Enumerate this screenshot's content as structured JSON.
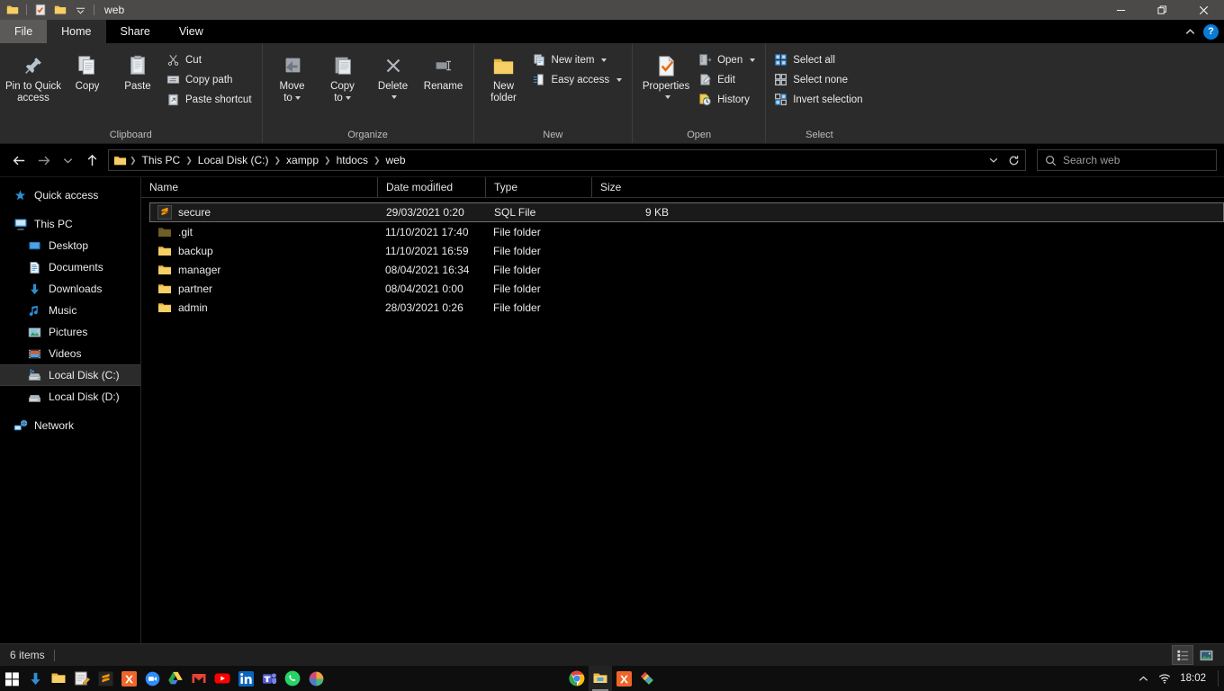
{
  "window": {
    "title": "web",
    "quick_access": [
      "folder-icon",
      "properties-icon",
      "new-folder-icon",
      "customize-qat-caret"
    ],
    "controls": {
      "minimize": "minimize-button",
      "maximize": "restore-button",
      "close": "close-button"
    }
  },
  "ribbon": {
    "tabs": [
      {
        "label": "File",
        "state": "file"
      },
      {
        "label": "Home",
        "state": "active"
      },
      {
        "label": "Share",
        "state": "normal"
      },
      {
        "label": "View",
        "state": "normal"
      }
    ],
    "collapse_label": "^",
    "help_label": "?",
    "groups": [
      {
        "label": "Clipboard",
        "big": [
          {
            "label1": "Pin to Quick",
            "label2": "access",
            "icon": "pin-icon"
          },
          {
            "label1": "Copy",
            "label2": "",
            "icon": "copy-icon"
          },
          {
            "label1": "Paste",
            "label2": "",
            "icon": "paste-icon"
          }
        ],
        "small": [
          {
            "label": "Cut",
            "icon": "scissors-icon"
          },
          {
            "label": "Copy path",
            "icon": "copy-path-icon"
          },
          {
            "label": "Paste shortcut",
            "icon": "paste-shortcut-icon"
          }
        ]
      },
      {
        "label": "Organize",
        "big": [
          {
            "label1": "Move",
            "label2": "to",
            "icon": "move-to-icon",
            "caret": true
          },
          {
            "label1": "Copy",
            "label2": "to",
            "icon": "copy-to-icon",
            "caret": true
          },
          {
            "label1": "Delete",
            "label2": "",
            "icon": "delete-icon",
            "caret_below": true
          },
          {
            "label1": "Rename",
            "label2": "",
            "icon": "rename-icon"
          }
        ],
        "small": []
      },
      {
        "label": "New",
        "big": [
          {
            "label1": "New",
            "label2": "folder",
            "icon": "new-folder-icon"
          }
        ],
        "small": [
          {
            "label": "New item",
            "icon": "new-item-icon",
            "caret": true
          },
          {
            "label": "Easy access",
            "icon": "easy-access-icon",
            "caret": true
          }
        ]
      },
      {
        "label": "Open",
        "big": [
          {
            "label1": "Properties",
            "label2": "",
            "icon": "properties-icon",
            "caret_below": true
          }
        ],
        "small": [
          {
            "label": "Open",
            "icon": "open-icon",
            "caret": true
          },
          {
            "label": "Edit",
            "icon": "edit-icon"
          },
          {
            "label": "History",
            "icon": "history-icon"
          }
        ]
      },
      {
        "label": "Select",
        "big": [],
        "small": [
          {
            "label": "Select all",
            "icon": "select-all-icon"
          },
          {
            "label": "Select none",
            "icon": "select-none-icon"
          },
          {
            "label": "Invert selection",
            "icon": "invert-selection-icon"
          }
        ]
      }
    ]
  },
  "address": {
    "back": "back-icon",
    "forward": "forward-icon",
    "recent": "recent-locations-icon",
    "up": "up-icon",
    "crumbs": [
      "This PC",
      "Local Disk (C:)",
      "xampp",
      "htdocs",
      "web"
    ],
    "dropdown": "address-dropdown-icon",
    "refresh": "refresh-icon",
    "search_placeholder": "Search web",
    "search_value": ""
  },
  "nav_pane": {
    "items": [
      {
        "label": "Quick access",
        "icon": "star-icon",
        "indent": false,
        "selected": false
      },
      {
        "label": "This PC",
        "icon": "this-pc-icon",
        "indent": false,
        "selected": false
      },
      {
        "label": "Desktop",
        "icon": "desktop-icon",
        "indent": true,
        "selected": false
      },
      {
        "label": "Documents",
        "icon": "documents-icon",
        "indent": true,
        "selected": false
      },
      {
        "label": "Downloads",
        "icon": "downloads-icon",
        "indent": true,
        "selected": false
      },
      {
        "label": "Music",
        "icon": "music-icon",
        "indent": true,
        "selected": false
      },
      {
        "label": "Pictures",
        "icon": "pictures-icon",
        "indent": true,
        "selected": false
      },
      {
        "label": "Videos",
        "icon": "videos-icon",
        "indent": true,
        "selected": false
      },
      {
        "label": "Local Disk (C:)",
        "icon": "drive-icon",
        "indent": true,
        "selected": true
      },
      {
        "label": "Local Disk (D:)",
        "icon": "drive-plain-icon",
        "indent": true,
        "selected": false
      },
      {
        "label": "Network",
        "icon": "network-icon",
        "indent": false,
        "selected": false
      }
    ]
  },
  "file_list": {
    "columns": [
      {
        "label": "Name",
        "sorted": false
      },
      {
        "label": "Date modified",
        "sorted": true
      },
      {
        "label": "Type",
        "sorted": false
      },
      {
        "label": "Size",
        "sorted": false
      }
    ],
    "rows": [
      {
        "name": "secure",
        "date": "29/03/2021 0:20",
        "type": "SQL File",
        "size": "9 KB",
        "icon": "sublime-file-icon",
        "selected": true
      },
      {
        "name": ".git",
        "date": "11/10/2021 17:40",
        "type": "File folder",
        "size": "",
        "icon": "folder-hidden-icon",
        "selected": false
      },
      {
        "name": "backup",
        "date": "11/10/2021 16:59",
        "type": "File folder",
        "size": "",
        "icon": "folder-icon",
        "selected": false
      },
      {
        "name": "manager",
        "date": "08/04/2021 16:34",
        "type": "File folder",
        "size": "",
        "icon": "folder-icon",
        "selected": false
      },
      {
        "name": "partner",
        "date": "08/04/2021 0:00",
        "type": "File folder",
        "size": "",
        "icon": "folder-icon",
        "selected": false
      },
      {
        "name": "admin",
        "date": "28/03/2021 0:26",
        "type": "File folder",
        "size": "",
        "icon": "folder-icon",
        "selected": false
      }
    ]
  },
  "status_bar": {
    "item_count": "6 items",
    "view_details": "details-view-button",
    "view_large": "large-icons-view-button"
  },
  "taskbar": {
    "left": [
      "start-icon",
      "download-icon",
      "folder-icon",
      "notepad-icon",
      "sublime-icon",
      "xampp-icon",
      "zoom-icon",
      "google-drive-icon",
      "gmail-icon",
      "youtube-icon",
      "linkedin-icon",
      "teams-icon",
      "whatsapp-icon",
      "app-icon"
    ],
    "center": [
      "chrome-icon",
      "file-explorer-icon",
      "xampp-icon",
      "paint-icon"
    ],
    "tray": {
      "chevron": "show-hidden-icons",
      "wifi": "wifi-icon",
      "clock": "18:02"
    }
  },
  "colors": {
    "accent_blue": "#0a7bd6",
    "folder_yellow": "#f6c954",
    "sublime_orange": "#ff9800",
    "titlebar": "#4c4a48",
    "ribbon_bg": "#2b2b2b"
  }
}
